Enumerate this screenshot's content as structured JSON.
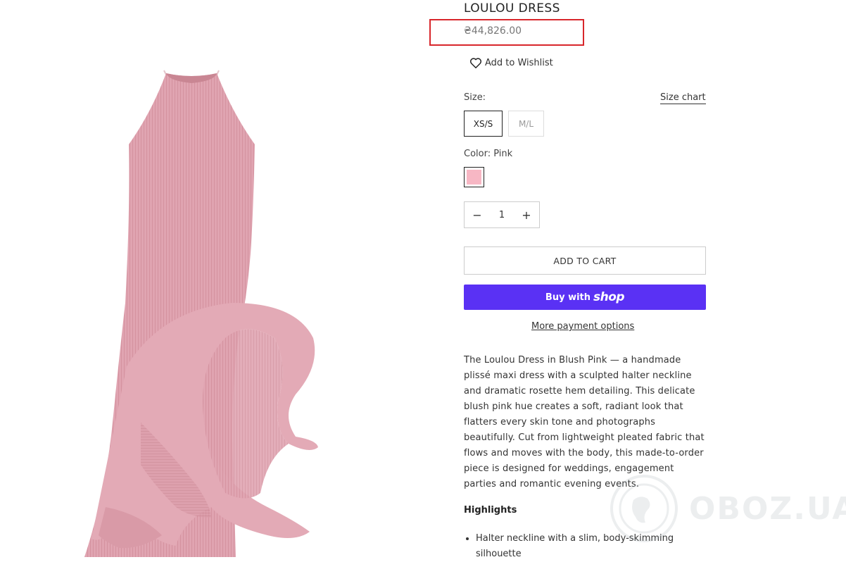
{
  "product": {
    "title": "LOULOU DRESS",
    "price": "₴44,826.00",
    "wishlist_label": "Add to Wishlist"
  },
  "size": {
    "label": "Size:",
    "chart_link": "Size chart",
    "options": [
      "XS/S",
      "M/L"
    ],
    "selected": "XS/S"
  },
  "color": {
    "label": "Color: Pink",
    "swatch_color": "#f7b7c4"
  },
  "quantity": {
    "minus": "−",
    "value": "1",
    "plus": "+"
  },
  "actions": {
    "add_to_cart": "ADD TO CART",
    "shop_pay_prefix": "Buy with",
    "shop_pay_brand": "shop",
    "more_payment": "More payment options"
  },
  "description": "The Loulou Dress in Blush Pink — a handmade plissé maxi dress with a sculpted halter neckline and dramatic rosette hem detailing. This delicate blush pink hue creates a soft, radiant look that flatters every skin tone and photographs beautifully. Cut from lightweight pleated fabric that flows and moves with the body, this made-to-order piece is designed for weddings, engagement parties and romantic evening events.",
  "highlights": {
    "heading": "Highlights",
    "items": [
      "Halter neckline with a slim, body-skimming silhouette"
    ]
  },
  "watermark": "OBOZ.UA",
  "colors": {
    "accent_highlight": "#d8262b",
    "shop_pay": "#5a31f4",
    "dress": "#dfa3b0"
  }
}
